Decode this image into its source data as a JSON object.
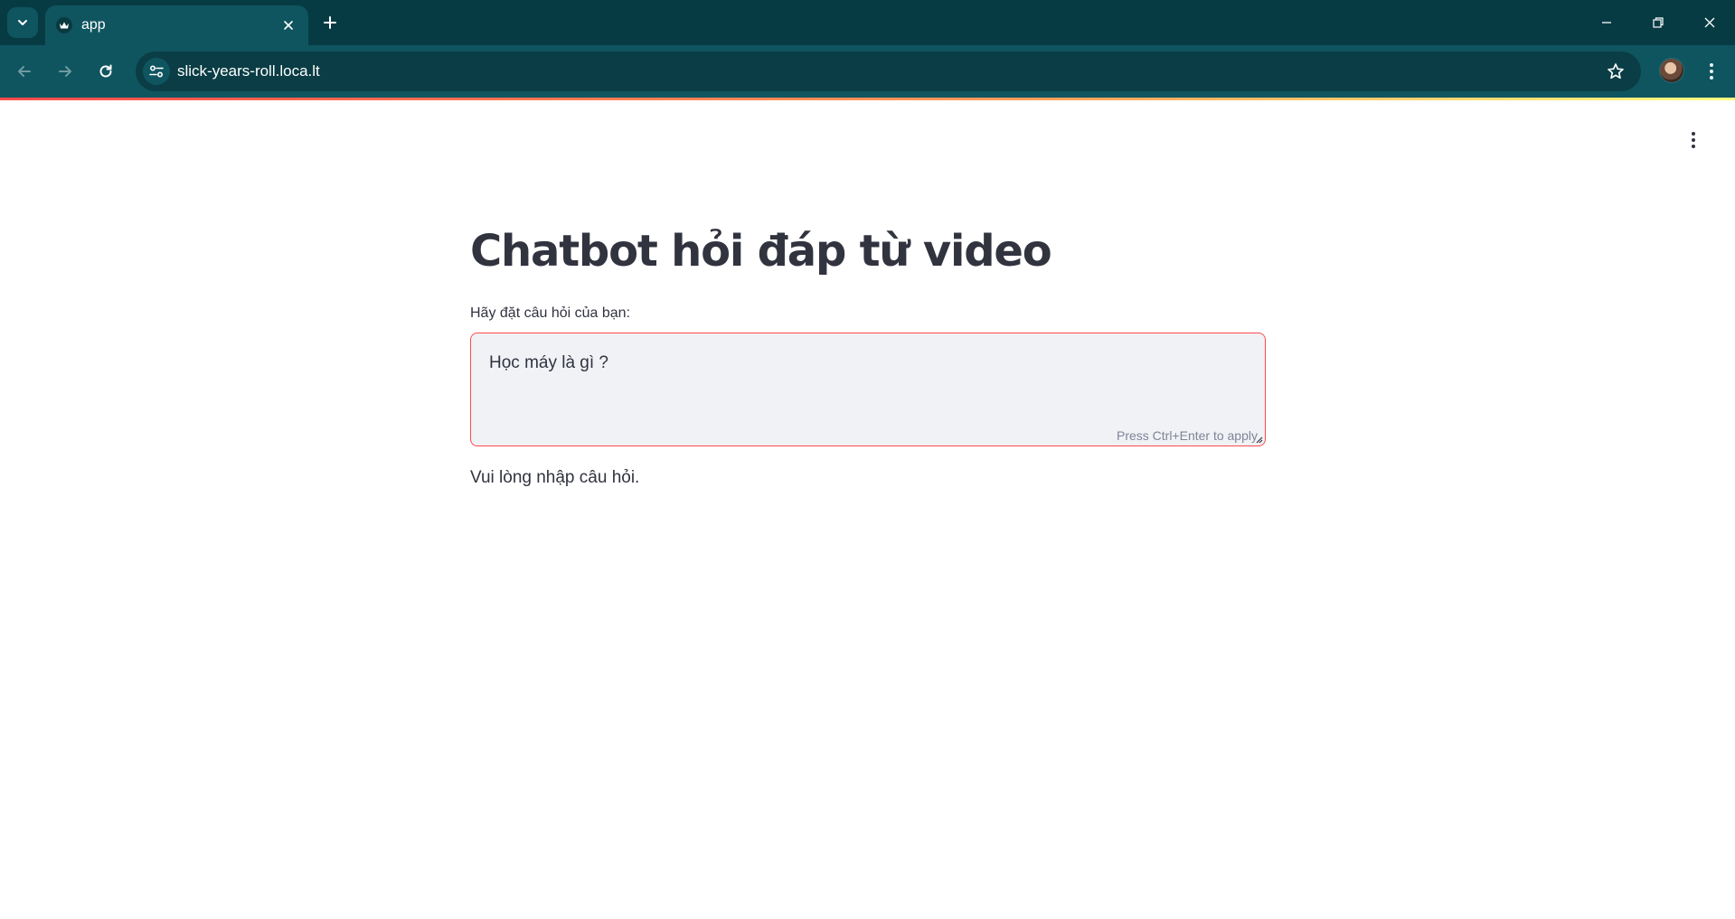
{
  "browser": {
    "tab_title": "app",
    "url": "slick-years-roll.loca.lt",
    "icons": {
      "tab_search": "chevron-down-icon",
      "favicon": "crown-icon",
      "tab_close": "close-icon",
      "new_tab": "plus-icon",
      "minimize": "minimize-icon",
      "restore": "restore-icon",
      "window_close": "close-icon",
      "back": "arrow-left-icon",
      "forward": "arrow-right-icon",
      "reload": "reload-icon",
      "site_info": "tune-icon",
      "bookmark": "star-icon",
      "menu": "more-vert-icon"
    },
    "colors": {
      "tabbar": "#073b44",
      "toolbar": "#0f5560",
      "omnibox": "#0a3d45"
    }
  },
  "app": {
    "title": "Chatbot hỏi đáp từ video",
    "input_label": "Hãy đặt câu hỏi của bạn:",
    "input_value": "Học máy là gì ?",
    "input_hint": "Press Ctrl+Enter to apply",
    "message": "Vui lòng nhập câu hỏi.",
    "colors": {
      "text": "#31333f",
      "input_bg": "#f0f2f6",
      "focus_border": "#ff4b4b",
      "hint": "#808495"
    }
  }
}
